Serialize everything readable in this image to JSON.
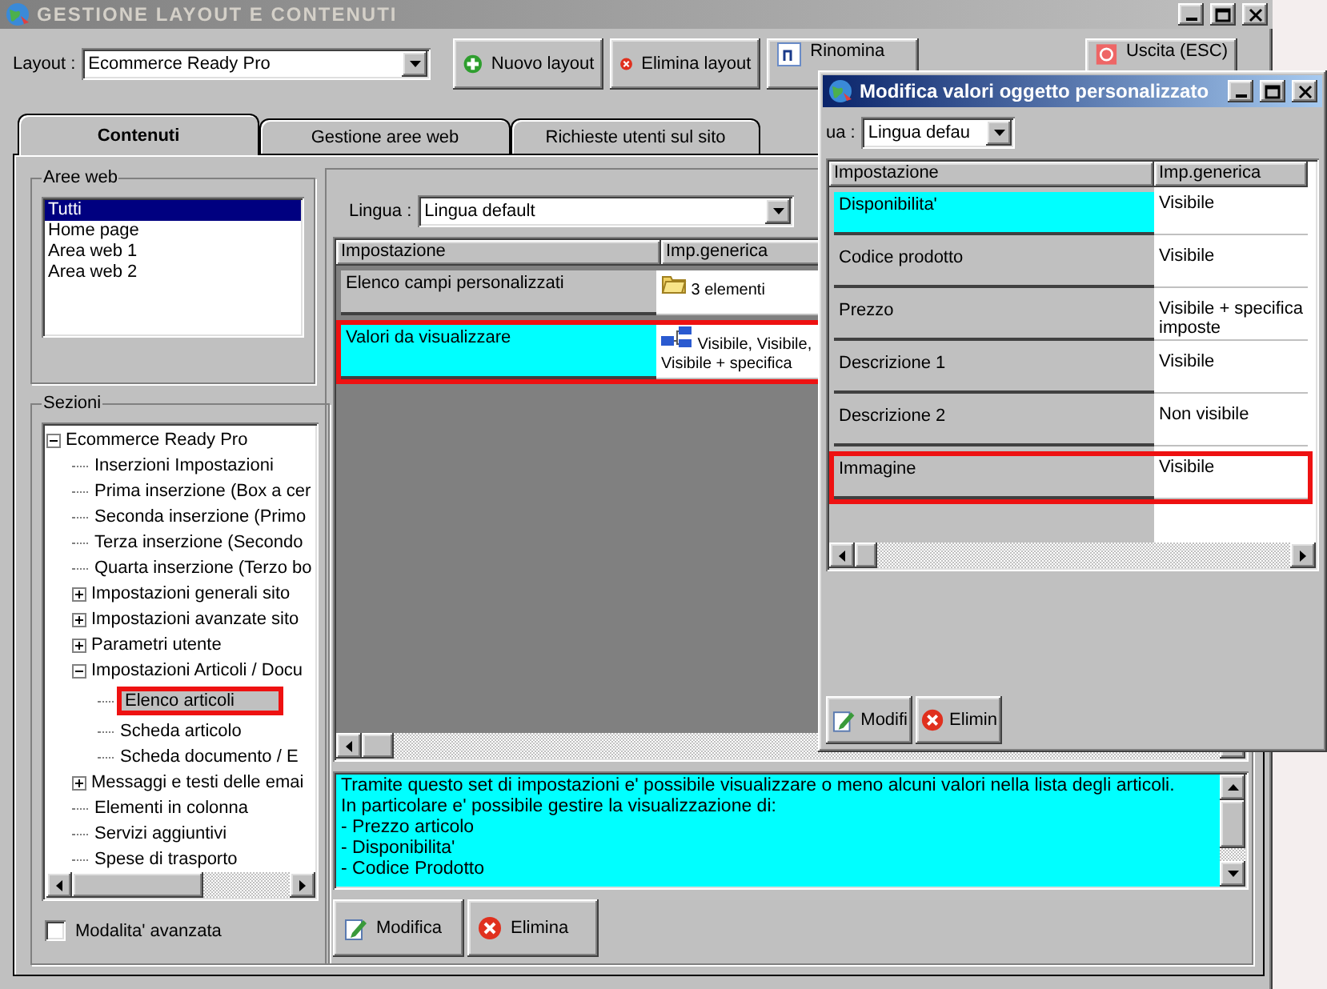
{
  "window": {
    "title": "GESTIONE LAYOUT E CONTENUTI",
    "active": false
  },
  "toolbar": {
    "layout_label": "Layout :",
    "layout_value": "Ecommerce Ready Pro",
    "buttons": [
      {
        "label": "Nuovo layout",
        "kind": "add"
      },
      {
        "label": "Elimina layout",
        "kind": "delete"
      },
      {
        "label": "Rinomina",
        "kind": "rename"
      },
      {
        "label": "Uscita (ESC)",
        "kind": "exit"
      }
    ]
  },
  "tabs": [
    {
      "label": "Contenuti",
      "selected": true
    },
    {
      "label": "Gestione aree web",
      "selected": false
    },
    {
      "label": "Richieste utenti sul sito",
      "selected": false
    }
  ],
  "aree_web": {
    "title": "Aree web",
    "items": [
      {
        "label": "Tutti",
        "selected": true
      },
      {
        "label": "Home page",
        "selected": false
      },
      {
        "label": "Area web 1",
        "selected": false
      },
      {
        "label": "Area web 2",
        "selected": false
      }
    ]
  },
  "sezioni": {
    "title": "Sezioni",
    "tree": [
      {
        "label": "Ecommerce Ready Pro",
        "expanded": true,
        "selected": false,
        "highlighted": false,
        "children": [
          {
            "label": "Inserzioni Impostazioni",
            "selected": false,
            "highlighted": false
          },
          {
            "label": "Prima inserzione (Box a cer",
            "selected": false,
            "highlighted": false
          },
          {
            "label": "Seconda inserzione (Primo",
            "selected": false,
            "highlighted": false
          },
          {
            "label": "Terza inserzione (Secondo",
            "selected": false,
            "highlighted": false
          },
          {
            "label": "Quarta inserzione (Terzo bo",
            "selected": false,
            "highlighted": false
          },
          {
            "label": "Impostazioni generali sito",
            "expanded": false,
            "selected": false,
            "highlighted": false
          },
          {
            "label": "Impostazioni avanzate sito",
            "expanded": false,
            "selected": false,
            "highlighted": false
          },
          {
            "label": "Parametri utente",
            "expanded": false,
            "selected": false,
            "highlighted": false
          },
          {
            "label": "Impostazioni Articoli / Docu",
            "expanded": true,
            "selected": false,
            "highlighted": false,
            "children": [
              {
                "label": "Elenco articoli",
                "selected": true,
                "highlighted": true
              },
              {
                "label": "Scheda articolo",
                "selected": false,
                "highlighted": false
              },
              {
                "label": "Scheda documento / E",
                "selected": false,
                "highlighted": false
              }
            ]
          },
          {
            "label": "Messaggi e testi delle emai",
            "expanded": false,
            "selected": false,
            "highlighted": false
          },
          {
            "label": "Elementi in colonna",
            "selected": false,
            "highlighted": false
          },
          {
            "label": "Servizi aggiuntivi",
            "selected": false,
            "highlighted": false
          },
          {
            "label": "Spese di trasporto",
            "selected": false,
            "highlighted": false
          }
        ]
      }
    ]
  },
  "advanced_mode": {
    "label": "Modalita' avanzata",
    "checked": false
  },
  "content": {
    "language_label": "Lingua :",
    "language_value": "Lingua default",
    "columns": [
      "Impostazione",
      "Imp.generica"
    ],
    "rows": [
      {
        "setting": "Elenco campi personalizzati",
        "value": "3 elementi",
        "kind": "folder",
        "selected": false,
        "highlighted": false
      },
      {
        "setting": "Valori da visualizzare",
        "value": "Visibile, Visibile, Visibile + specifica",
        "kind": "list",
        "selected": true,
        "highlighted": true
      }
    ],
    "description": "Tramite questo set di impostazioni e' possibile visualizzare o meno alcuni valori nella lista degli articoli.\nIn particolare e' possibile gestire la visualizzazione di:\n- Prezzo articolo\n- Disponibilita'\n- Codice Prodotto",
    "buttons": [
      {
        "label": "Modifica",
        "kind": "edit"
      },
      {
        "label": "Elimina",
        "kind": "delete"
      }
    ]
  },
  "dialog": {
    "title": "Modifica valori oggetto personalizzato",
    "active": true,
    "language_label": "ua :",
    "language_value": "Lingua defau",
    "columns": [
      "Impostazione",
      "Imp.generica"
    ],
    "rows": [
      {
        "setting": "Disponibilita'",
        "value": "Visibile",
        "selected": true,
        "highlighted": false
      },
      {
        "setting": "Codice prodotto",
        "value": "Visibile",
        "selected": false,
        "highlighted": false
      },
      {
        "setting": "Prezzo",
        "value": "Visibile + specifica imposte",
        "selected": false,
        "highlighted": false
      },
      {
        "setting": "Descrizione 1",
        "value": "Visibile",
        "selected": false,
        "highlighted": false
      },
      {
        "setting": "Descrizione 2",
        "value": "Non visibile",
        "selected": false,
        "highlighted": false
      },
      {
        "setting": "Immagine",
        "value": "Visibile",
        "selected": false,
        "highlighted": true
      }
    ],
    "buttons": [
      {
        "label": "Modifi",
        "kind": "edit"
      },
      {
        "label": "Elimin",
        "kind": "delete"
      }
    ]
  }
}
